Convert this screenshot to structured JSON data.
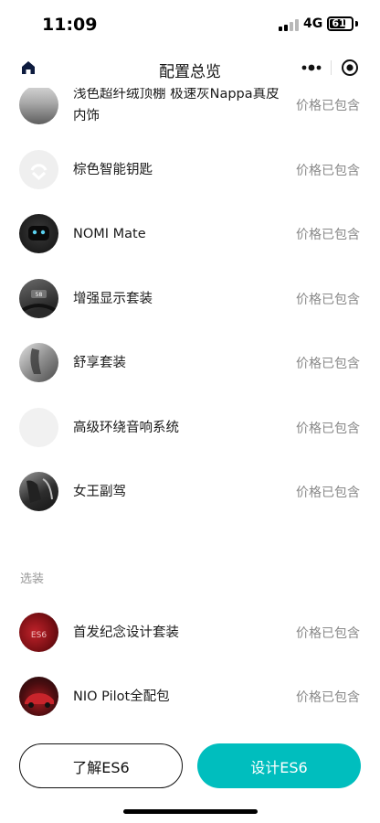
{
  "status_bar": {
    "time": "11:09",
    "network": "4G",
    "battery": "61"
  },
  "nav": {
    "title": "配置总览"
  },
  "included_items": [
    {
      "name": "浅色超纤绒顶棚 极速灰Nappa真皮内饰",
      "price": "价格已包含",
      "thumb": "thumb-headliner"
    },
    {
      "name": "棕色智能钥匙",
      "price": "价格已包含",
      "thumb": "thumb-key"
    },
    {
      "name": "NOMI Mate",
      "price": "价格已包含",
      "thumb": "thumb-nomi"
    },
    {
      "name": "增强显示套装",
      "price": "价格已包含",
      "thumb": "thumb-hud"
    },
    {
      "name": "舒享套装",
      "price": "价格已包含",
      "thumb": "thumb-comfort"
    },
    {
      "name": "高级环绕音响系统",
      "price": "价格已包含",
      "thumb": "thumb-audio"
    },
    {
      "name": "女王副驾",
      "price": "价格已包含",
      "thumb": "thumb-queen"
    }
  ],
  "optional_section": {
    "label": "选装",
    "items": [
      {
        "name": "首发纪念设计套装",
        "price": "价格已包含",
        "thumb": "thumb-edition"
      },
      {
        "name": "NIO Pilot全配包",
        "price": "价格已包含",
        "thumb": "thumb-pilot"
      }
    ]
  },
  "thumb_text": {
    "hud_speed": "58",
    "edition_badge": "ES6"
  },
  "actions": {
    "learn_label": "了解ES6",
    "design_label": "设计ES6"
  },
  "colors": {
    "accent": "#00bebe",
    "text_secondary": "#888888",
    "section_label": "#999999"
  }
}
